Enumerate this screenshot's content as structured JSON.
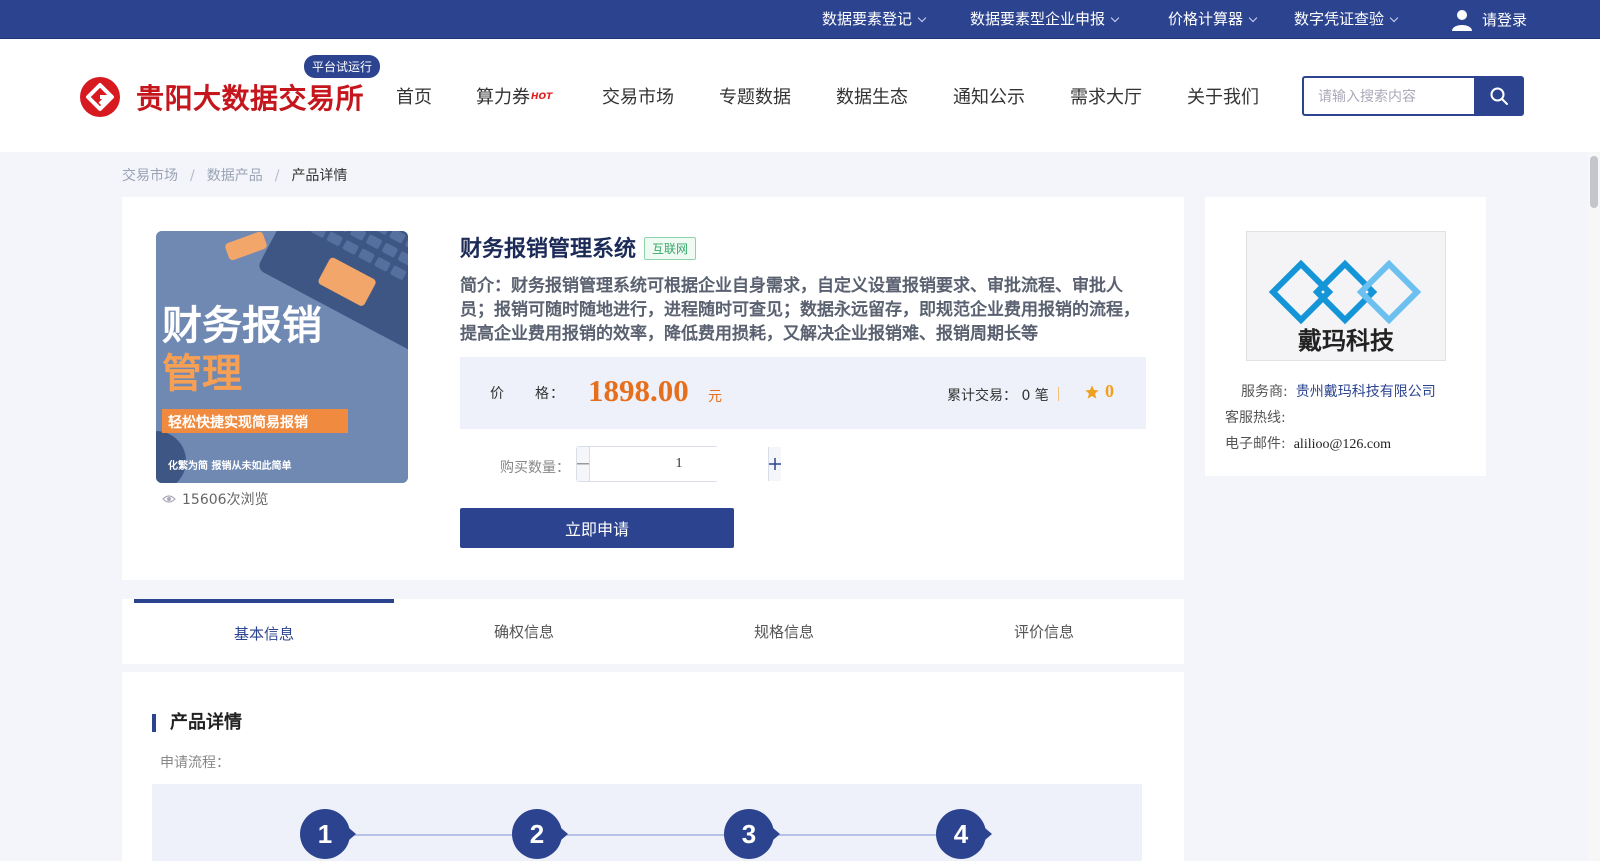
{
  "topbar": {
    "items": [
      {
        "label": "数据要素登记"
      },
      {
        "label": "数据要素型企业申报"
      },
      {
        "label": "价格计算器"
      },
      {
        "label": "数字凭证查验"
      }
    ],
    "login_label": "请登录"
  },
  "header": {
    "site_name": "贵阳大数据交易所",
    "beta_badge": "平台试运行",
    "nav": [
      {
        "label": "首页"
      },
      {
        "label": "算力券"
      },
      {
        "label": "交易市场"
      },
      {
        "label": "专题数据"
      },
      {
        "label": "数据生态"
      },
      {
        "label": "通知公示"
      },
      {
        "label": "需求大厅"
      },
      {
        "label": "关于我们"
      }
    ],
    "hot_badge": "HOT",
    "search_placeholder": "请输入搜索内容"
  },
  "breadcrumb": [
    "交易市场",
    "数据产品",
    "产品详情"
  ],
  "product": {
    "image_text_main": "财务报销",
    "image_text_sub": "管理",
    "image_banner": "轻松快捷实现简易报销",
    "image_footer": "化繁为简 报销从未如此简单",
    "views": "15606次浏览",
    "title": "财务报销管理系统",
    "tag": "互联网",
    "intro": "简介：财务报销管理系统可根据企业自身需求，自定义设置报销要求、审批流程、审批人员；报销可随时随地进行，进程随时可查见；数据永远留存，即规范企业费用报销的流程，提高企业费用报销的效率，降低费用损耗，又解决企业报销难、报销周期长等",
    "price_label": "价　　格：",
    "price": "1898.00",
    "price_unit": "元",
    "tx_label": "累计交易：",
    "tx_count": "0 笔",
    "rating": "0",
    "qty_label": "购买数量：",
    "qty_value": "1",
    "apply_label": "立即申请"
  },
  "provider": {
    "logo_text": "戴玛科技",
    "provider_label": "服务商:",
    "provider_name": "贵州戴玛科技有限公司",
    "hotline_label": "客服热线:",
    "hotline": "",
    "email_label": "电子邮件:",
    "email": "alilioo@126.com"
  },
  "tabs": [
    {
      "label": "基本信息",
      "active": true
    },
    {
      "label": "确权信息",
      "active": false
    },
    {
      "label": "规格信息",
      "active": false
    },
    {
      "label": "评价信息",
      "active": false
    }
  ],
  "details": {
    "section_title": "产品详情",
    "flow_label": "申请流程：",
    "steps": [
      "1",
      "2",
      "3",
      "4"
    ]
  },
  "colors": {
    "brand": "#2c4490",
    "logo_red": "#c4161c",
    "price_orange": "#e66f1d",
    "tag_green": "#39a86b"
  }
}
